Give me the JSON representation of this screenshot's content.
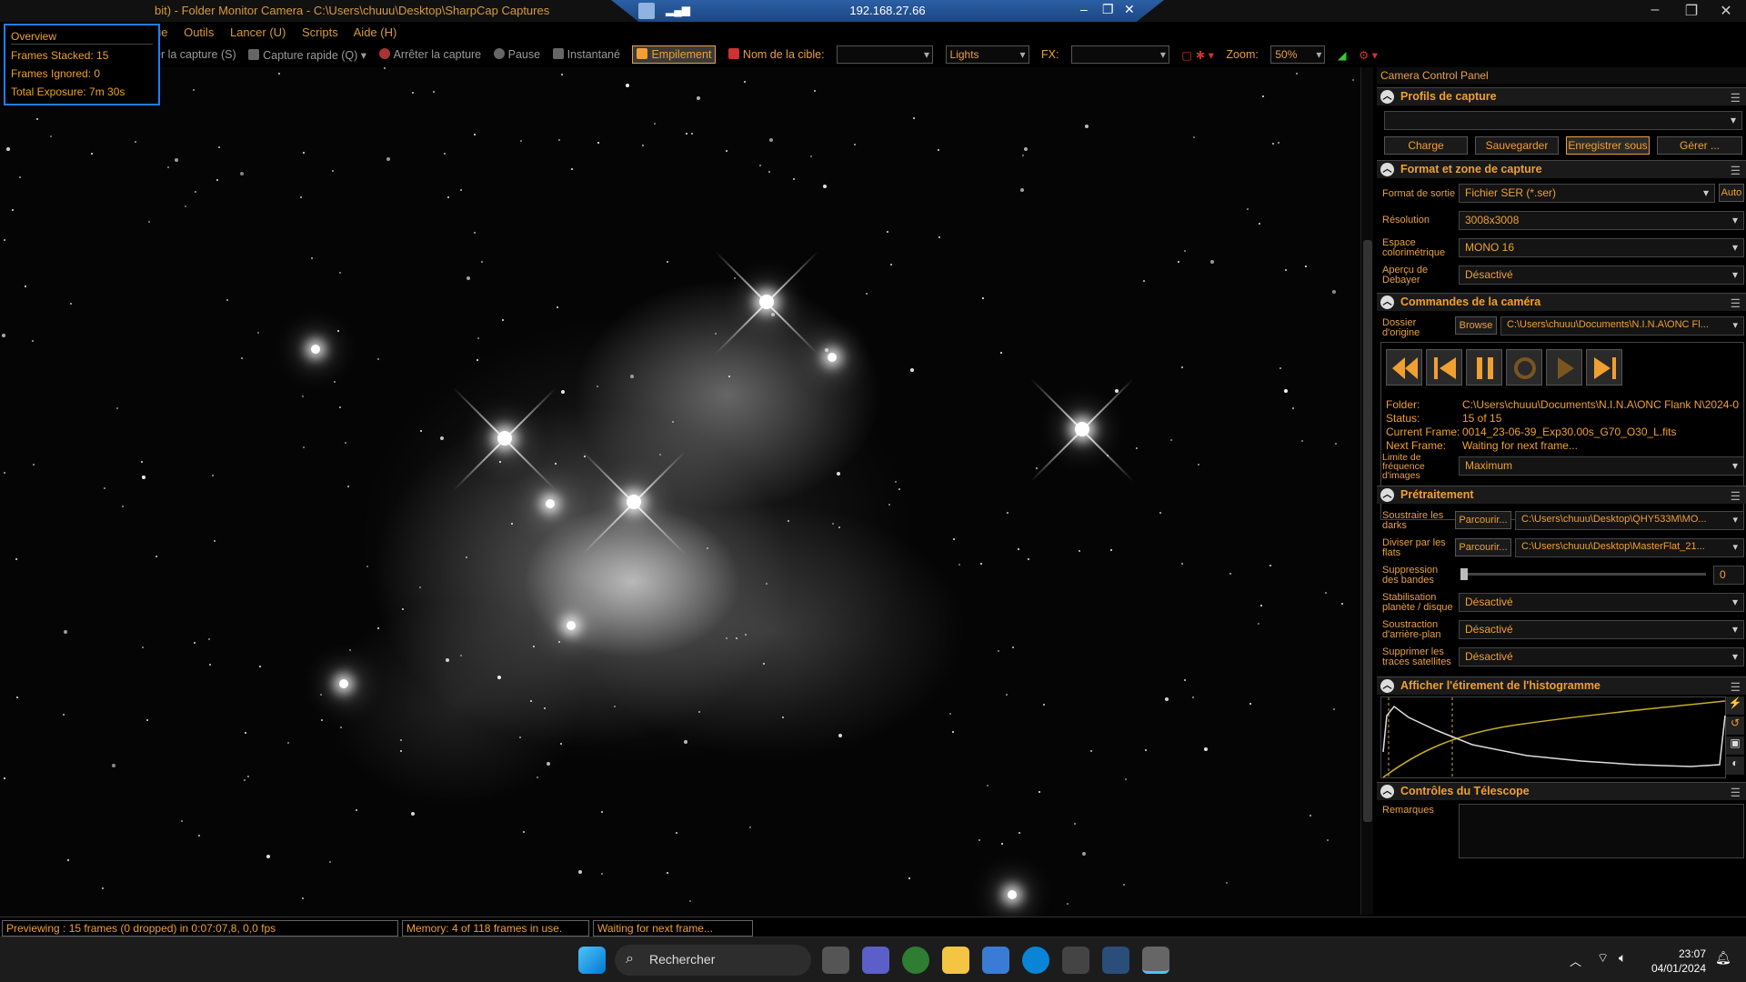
{
  "window": {
    "title": "bit) - Folder Monitor Camera - C:\\Users\\chuuu\\Desktop\\SharpCap Captures",
    "remote_ip": "192.168.27.66"
  },
  "menu": [
    "ue",
    "Outils",
    "Lancer (U)",
    "Scripts",
    "Aide (H)"
  ],
  "toolbar": {
    "start_capture": "er la capture (S)",
    "quick_capture": "Capture rapide (Q)",
    "stop_capture": "Arrêter la capture",
    "pause": "Pause",
    "snapshot": "Instantané",
    "stacking": "Empilement",
    "target_label": "Nom de la cible:",
    "target_value": "",
    "frame_type": "Lights",
    "fx_label": "FX:",
    "fx_value": "",
    "zoom_label": "Zoom:",
    "zoom_value": "50%"
  },
  "overview": {
    "title": "Overview",
    "stacked": "Frames Stacked: 15",
    "ignored": "Frames Ignored: 0",
    "exposure": "Total Exposure:   7m 30s"
  },
  "panel": {
    "title": "Camera Control Panel",
    "profiles": {
      "header": "Profils de capture",
      "selected": "",
      "load": "Charge",
      "save": "Sauvegarder",
      "save_as": "Enregistrer sous",
      "manage": "Gérer ..."
    },
    "format": {
      "header": "Format et zone de capture",
      "output_label": "Format de sortie",
      "output_value": "Fichier SER (*.ser)",
      "auto": "Auto",
      "res_label": "Résolution",
      "res_value": "3008x3008",
      "color_label": "Espace colorimétrique",
      "color_value": "MONO 16",
      "debayer_label": "Aperçu de Debayer",
      "debayer_value": "Désactivé"
    },
    "camera": {
      "header": "Commandes de la caméra",
      "source_label": "Dossier d'origine",
      "browse": "Browse",
      "source_value": "C:\\Users\\chuuu\\Documents\\N.I.N.A\\ONC Fl...",
      "folder_label": "Folder:",
      "folder_value": "C:\\Users\\chuuu\\Documents\\N.I.N.A\\ONC Flank N\\2024-0",
      "status_label": "Status:",
      "status_value": "15 of 15",
      "current_label": "Current Frame:",
      "current_value": "0014_23-06-39_Exp30.00s_G70_O30_L.fits",
      "next_label": "Next Frame:",
      "next_value": "Waiting for next frame...",
      "fps_label": "Limite de fréquence d'images",
      "fps_value": "Maximum"
    },
    "preprocessing": {
      "header": "Prétraitement",
      "darks_label": "Soustraire les darks",
      "darks_browse": "Parcourir...",
      "darks_value": "C:\\Users\\chuuu\\Desktop\\QHY533M\\MO...",
      "flats_label": "Diviser par les flats",
      "flats_browse": "Parcourir...",
      "flats_value": "C:\\Users\\chuuu\\Desktop\\MasterFlat_21...",
      "banding_label": "Suppression des bandes",
      "banding_value": "0",
      "stab_label": "Stabilisation planète / disque",
      "stab_value": "Désactivé",
      "bg_label": "Soustraction d'arrière-plan",
      "bg_value": "Désactivé",
      "sat_label": "Supprimer les traces satellites",
      "sat_value": "Désactivé"
    },
    "histogram": {
      "header": "Afficher l'étirement de l'histogramme"
    },
    "telescope": {
      "header": "Contrôles du Télescope",
      "notes_label": "Remarques"
    }
  },
  "status": {
    "preview": "Previewing : 15 frames (0 dropped) in 0:07:07,8, 0,0 fps",
    "memory": "Memory: 4 of 118 frames in use.",
    "waiting": "Waiting for next frame..."
  },
  "taskbar": {
    "search_placeholder": "Rechercher",
    "time": "23:07",
    "date": "04/01/2024"
  },
  "colors": {
    "accent": "#f0a030",
    "highlight": "#1e7fff",
    "taskbar": "#1c1c1c"
  }
}
